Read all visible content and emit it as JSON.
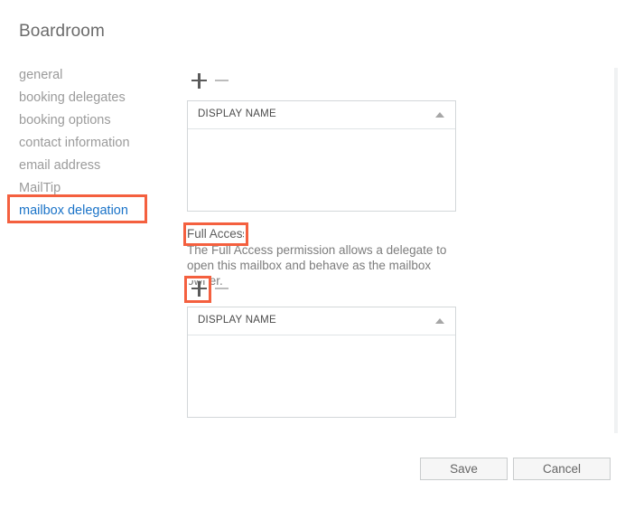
{
  "dialog": {
    "title": "Boardroom"
  },
  "sidebar": {
    "items": [
      {
        "label": "general",
        "active": false
      },
      {
        "label": "booking delegates",
        "active": false
      },
      {
        "label": "booking options",
        "active": false
      },
      {
        "label": "contact information",
        "active": false
      },
      {
        "label": "email address",
        "active": false
      },
      {
        "label": "MailTip",
        "active": false
      },
      {
        "label": "mailbox delegation",
        "active": true
      }
    ]
  },
  "main": {
    "send_as": {
      "toolbar": {
        "add_label": "+",
        "remove_label": "−"
      },
      "list": {
        "column_header": "DISPLAY NAME",
        "sort_direction": "ascending",
        "rows": []
      }
    },
    "full_access": {
      "heading": "Full Access",
      "description": "The Full Access permission allows a delegate to open this mailbox and behave as the mailbox owner.",
      "toolbar": {
        "add_label": "+",
        "remove_label": "−"
      },
      "list": {
        "column_header": "DISPLAY NAME",
        "sort_direction": "ascending",
        "rows": []
      }
    }
  },
  "footer": {
    "save_label": "Save",
    "cancel_label": "Cancel"
  },
  "annotations": {
    "color": "#f4603f",
    "targets": [
      "mailbox delegation",
      "Full Access",
      "add button"
    ]
  }
}
